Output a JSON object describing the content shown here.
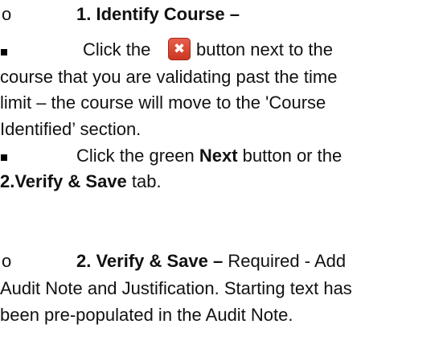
{
  "section1": {
    "marker": "o",
    "heading": "1. Identify Course –",
    "step1": {
      "before": "Click the",
      "icon": "x-icon",
      "after_line1": "button next to the",
      "line2": "course that you are validating past the time",
      "line3": "limit – the course will move to the 'Course",
      "line4": "Identified’ section."
    },
    "step2": {
      "before": "Click the green ",
      "bold1": "Next",
      "after": " button or the",
      "bold2": "2.Verify & Save",
      "tail": " tab."
    }
  },
  "section2": {
    "marker": "o",
    "heading": "2. Verify & Save –",
    "text1": " Required - Add",
    "line2": "Audit Note and Justification. Starting text has",
    "line3": "been pre-populated in the Audit Note."
  },
  "icon_color": "#d9432c"
}
